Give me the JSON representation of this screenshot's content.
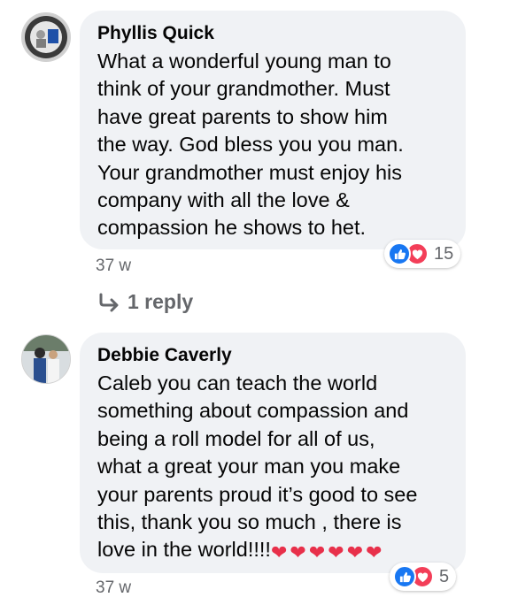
{
  "comments": [
    {
      "author": "Phyllis Quick",
      "text_lines": [
        "What a wonderful young man to",
        "think of your grandmother. Must",
        "have great parents to show him",
        "the way. God bless you you man.",
        "Your grandmother must enjoy his",
        "company with all the love &",
        "compassion he shows to het."
      ],
      "timestamp": "37 w",
      "reaction_count": "15",
      "reactions": [
        "like-icon",
        "love-icon"
      ],
      "reply_label": "1 reply"
    },
    {
      "author": "Debbie Caverly",
      "text_lines": [
        "Caleb you can teach the world",
        "something about compassion and",
        "being a roll model for all of us,",
        "what a great your man you make",
        "your parents proud it’s good to see",
        "this, thank you so much , there is",
        "love in the world!!!!"
      ],
      "trailing_emoji": "❤❤❤❤❤❤",
      "timestamp": "37 w",
      "reaction_count": "5",
      "reactions": [
        "like-icon",
        "love-icon"
      ]
    }
  ],
  "colors": {
    "bubble": "#f0f2f5",
    "secondary_text": "#65676b",
    "like": "#1877f2",
    "love": "#f33e58"
  }
}
